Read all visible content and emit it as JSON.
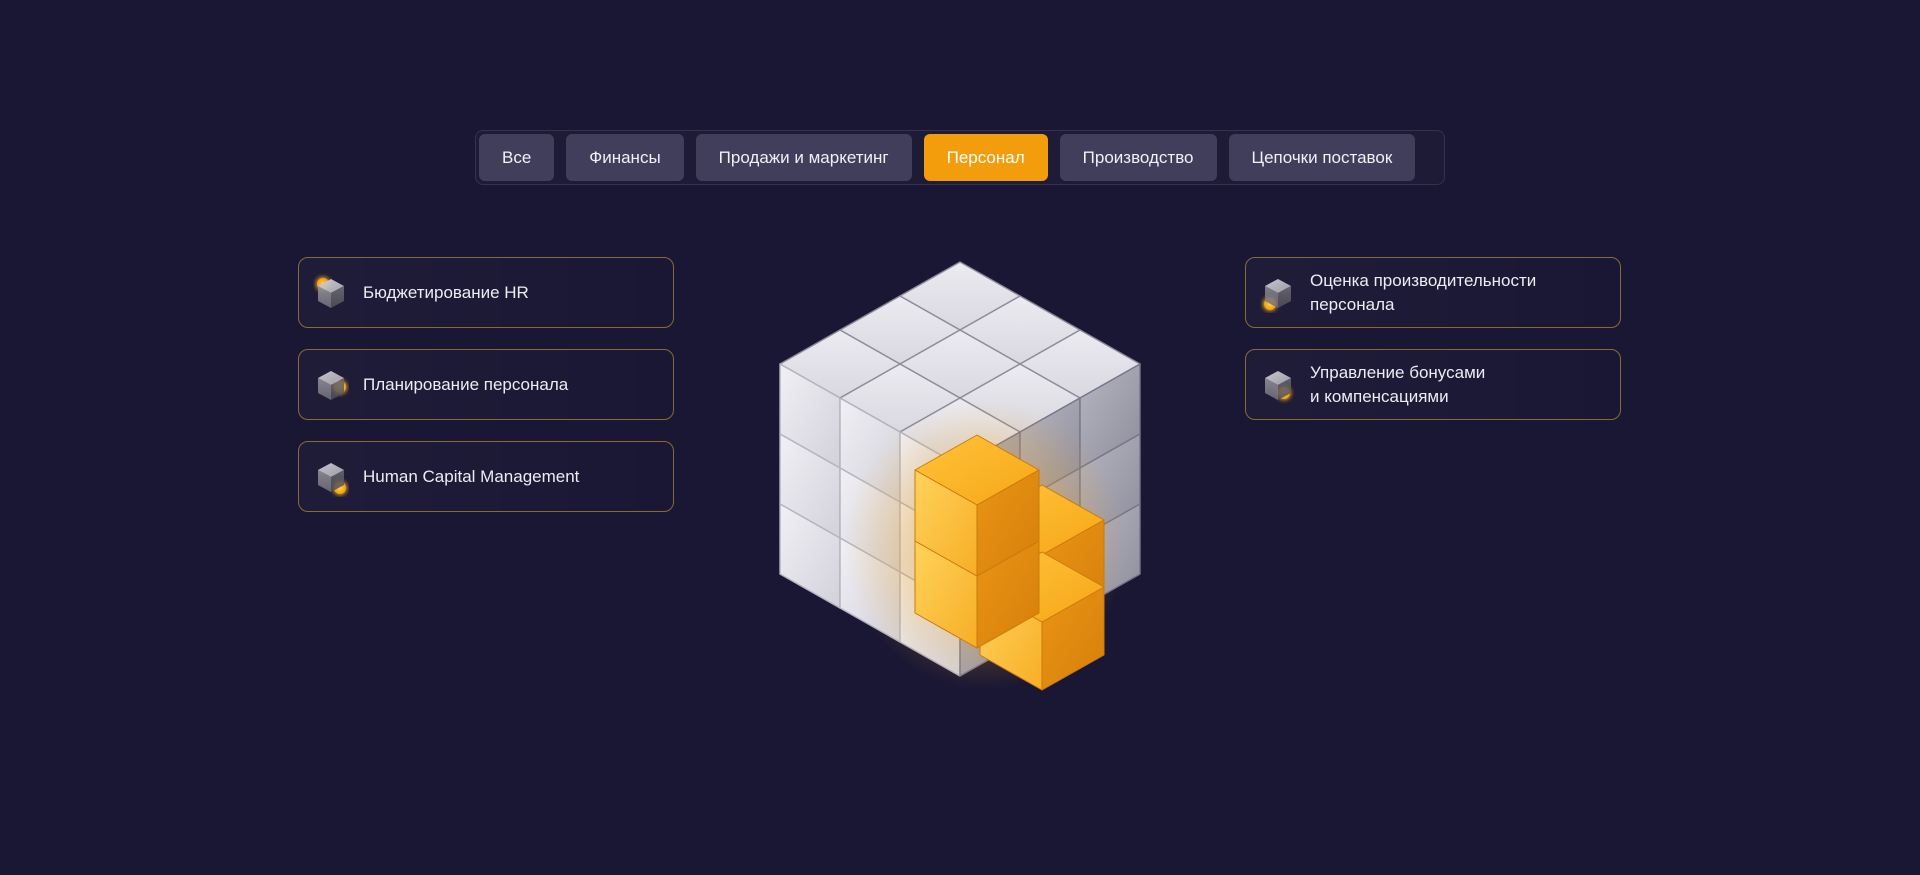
{
  "tabs": [
    {
      "label": "Все",
      "active": false
    },
    {
      "label": "Финансы",
      "active": false
    },
    {
      "label": "Продажи и маркетинг",
      "active": false
    },
    {
      "label": "Персонал",
      "active": true
    },
    {
      "label": "Производство",
      "active": false
    },
    {
      "label": "Цепочки поставок",
      "active": false
    }
  ],
  "cards_left": [
    {
      "label": "Бюджетирование HR",
      "icon": "cube-icon"
    },
    {
      "label": "Планирование персонала",
      "icon": "cube-icon"
    },
    {
      "label": "Human Capital Management",
      "icon": "cube-icon"
    }
  ],
  "cards_right": [
    {
      "line1": "Оценка производительности",
      "line2": "персонала",
      "icon": "cube-icon"
    },
    {
      "line1": "Управление бонусами",
      "line2": "и компенсациями",
      "icon": "cube-icon"
    }
  ],
  "colors": {
    "background": "#1a1734",
    "accent": "#f39c0c",
    "tab": "#403e5b",
    "card_border": "#8a6a33"
  }
}
